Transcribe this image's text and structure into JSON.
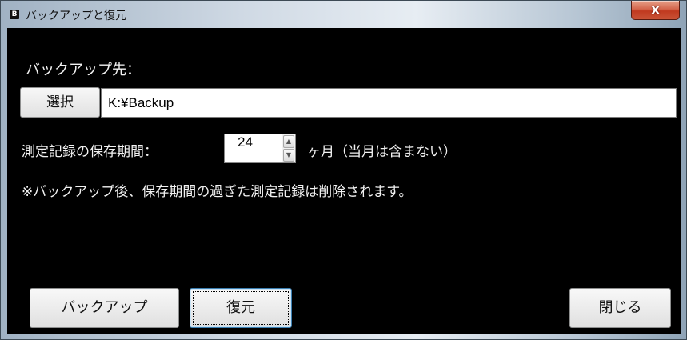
{
  "window": {
    "icon_letter": "B",
    "title": "バックアップと復元",
    "close_glyph": "x"
  },
  "backup_destination": {
    "label": "バックアップ先：",
    "select_button": "選択",
    "path": "K:¥Backup"
  },
  "retention": {
    "label": "測定記録の保存期間：",
    "value": "24",
    "unit_label": "ヶ月（当月は含まない）"
  },
  "note": "※バックアップ後、保存期間の過ぎた測定記録は削除されます。",
  "buttons": {
    "backup": "バックアップ",
    "restore": "復元",
    "close": "閉じる"
  },
  "colors": {
    "client_background": "#000000",
    "text": "#f2f2f2",
    "close_button": "#c0391f",
    "focus_border": "#3c7fb1"
  }
}
